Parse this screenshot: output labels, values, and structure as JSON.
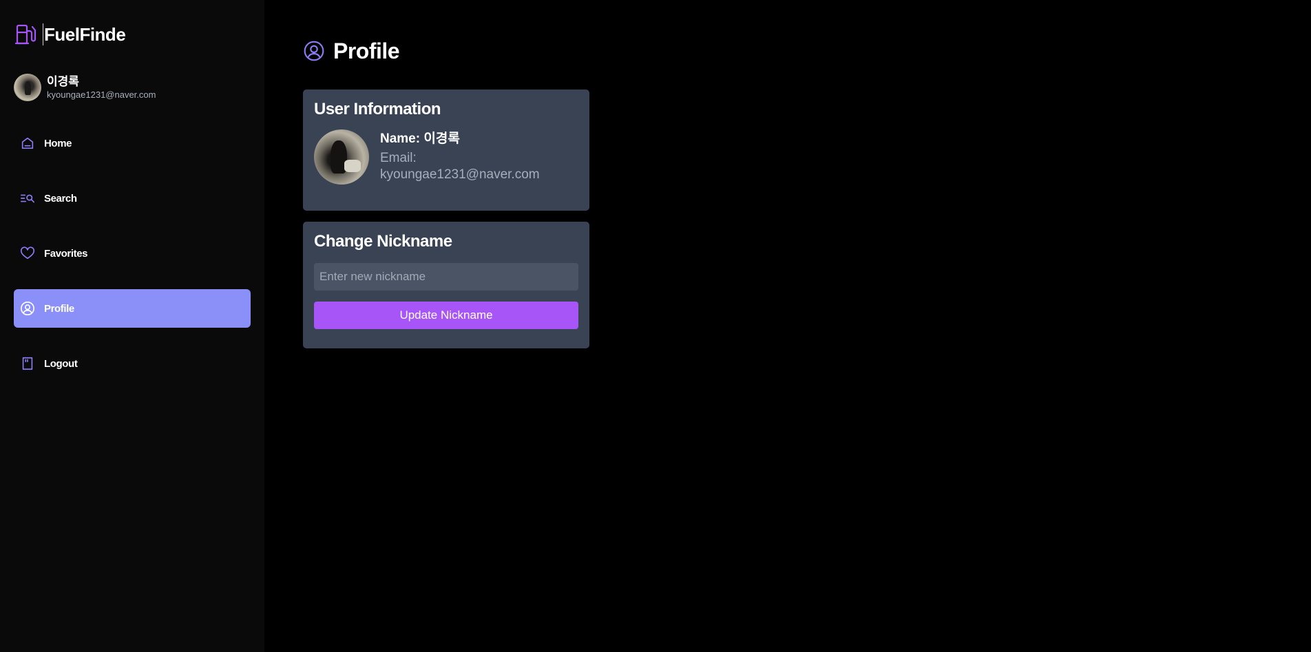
{
  "brand": {
    "name": "FuelFinde",
    "icon": "fuel-pump-icon"
  },
  "user": {
    "name": "이경록",
    "email": "kyoungae1231@naver.com"
  },
  "nav": {
    "items": [
      {
        "label": "Home",
        "icon": "home-icon"
      },
      {
        "label": "Search",
        "icon": "search-list-icon"
      },
      {
        "label": "Favorites",
        "icon": "heart-icon"
      },
      {
        "label": "Profile",
        "icon": "user-circle-icon",
        "active": true
      },
      {
        "label": "Logout",
        "icon": "door-icon"
      }
    ]
  },
  "page": {
    "title": "Profile",
    "icon": "user-circle-icon"
  },
  "user_info": {
    "title": "User Information",
    "name_label": "Name:",
    "name_value": "이경록",
    "email_label": "Email:",
    "email_value": "kyoungae1231@naver.com"
  },
  "nickname": {
    "title": "Change Nickname",
    "placeholder": "Enter new nickname",
    "button_label": "Update Nickname"
  },
  "colors": {
    "accent": "#a855f7",
    "active_nav": "#8b8ff8",
    "card_bg": "#394353",
    "icon_purple": "#8b7cf6"
  }
}
